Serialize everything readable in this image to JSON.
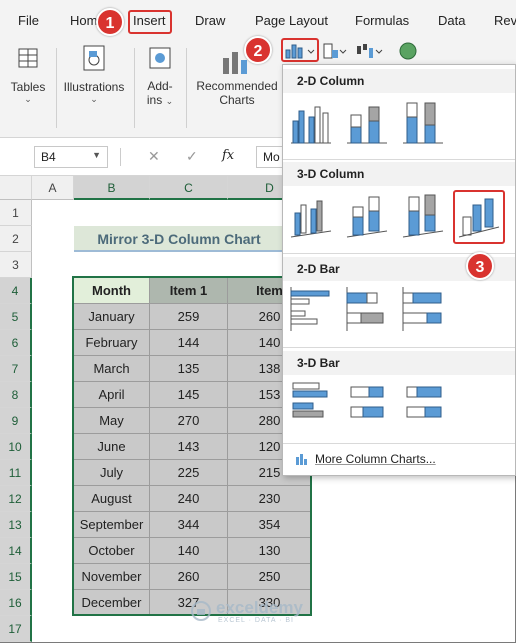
{
  "menu": [
    "File",
    "Home",
    "Insert",
    "Draw",
    "Page Layout",
    "Formulas",
    "Data",
    "Rev"
  ],
  "ribbon": {
    "tables": "Tables",
    "illustrations": "Illustrations",
    "addins_1": "Add-",
    "addins_2": "ins",
    "recommended_1": "Recommended",
    "recommended_2": "Charts"
  },
  "formula_bar": {
    "name_box": "B4",
    "fx": "fx",
    "content": "Mo"
  },
  "columns": [
    "A",
    "B",
    "C",
    "D"
  ],
  "rows": [
    "1",
    "2",
    "3",
    "4",
    "5",
    "6",
    "7",
    "8",
    "9",
    "10",
    "11",
    "12",
    "13",
    "14",
    "15",
    "16",
    "17"
  ],
  "sheet": {
    "title": "Mirror 3-D Column Chart",
    "headers": [
      "Month",
      "Item 1",
      "Item"
    ],
    "data": [
      [
        "January",
        "259",
        "260"
      ],
      [
        "February",
        "144",
        "140"
      ],
      [
        "March",
        "135",
        "138"
      ],
      [
        "April",
        "145",
        "153"
      ],
      [
        "May",
        "270",
        "280"
      ],
      [
        "June",
        "143",
        "120"
      ],
      [
        "July",
        "225",
        "215"
      ],
      [
        "August",
        "240",
        "230"
      ],
      [
        "September",
        "344",
        "354"
      ],
      [
        "October",
        "140",
        "130"
      ],
      [
        "November",
        "260",
        "250"
      ],
      [
        "December",
        "327",
        "330"
      ]
    ]
  },
  "dropdown": {
    "sections": [
      "2-D Column",
      "3-D Column",
      "2-D Bar",
      "3-D Bar"
    ],
    "more": "More Column Charts..."
  },
  "annotations": [
    "1",
    "2",
    "3"
  ],
  "watermark": {
    "name": "exceldemy",
    "tagline": "EXCEL · DATA · BI"
  },
  "colors": {
    "accent": "#217346",
    "annotation": "#d9332f",
    "chart_blue": "#5b9bd5",
    "chart_gray": "#a5a5a5"
  }
}
